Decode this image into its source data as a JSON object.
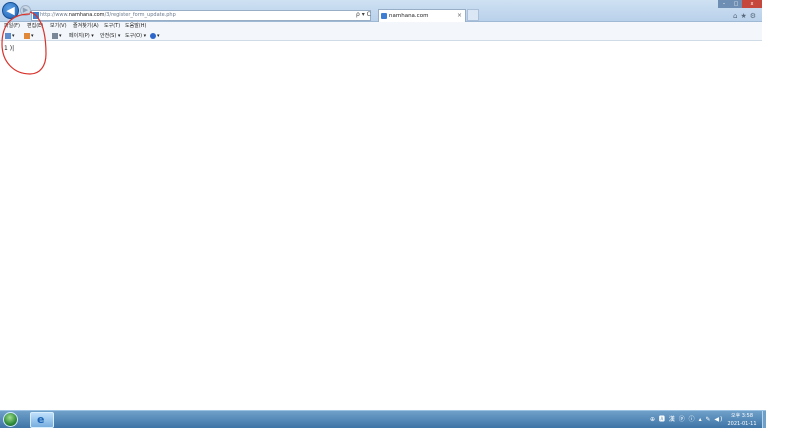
{
  "browser": {
    "url_prefix": "http://www.",
    "url_domain": "namhana.com",
    "url_path": "/3/register_form_update.php",
    "addr_tools": "ρ ▾ C",
    "tab_title": "namhana.com",
    "tab_close": "×",
    "right_icons": "⌂★⚙",
    "back_glyph": "◀",
    "fwd_glyph": "▶",
    "window_controls": {
      "minimize": "–",
      "maximize": "□",
      "close": "x"
    }
  },
  "menubar": {
    "items": [
      "편집(E)",
      "보기(V)",
      "즐겨찾기(A)",
      "도구(T)",
      "도움말(H)"
    ],
    "first_partial": "파일(F)"
  },
  "cmdbar": {
    "items": [
      {
        "label": "▾",
        "icon": "home-icon"
      },
      {
        "label": "▾",
        "icon": "feeds-icon"
      },
      {
        "label": "▾",
        "icon": "print-icon"
      },
      {
        "label": "페이지(P) ▾",
        "icon": ""
      },
      {
        "label": "안전(S) ▾",
        "icon": ""
      },
      {
        "label": "도구(O) ▾",
        "icon": ""
      },
      {
        "label": "▾",
        "icon": "help-icon"
      }
    ]
  },
  "page": {
    "text": "1 )|"
  },
  "taskbar": {
    "tray_text": "⊕ 🅰 漢 ⓟ ⓘ ▴ ✎ ◀)",
    "clock_time": "오후 3:58",
    "clock_date": "2021-01-11"
  },
  "colors": {
    "annotation": "#d9322b",
    "taskbar": "#3e74a6"
  }
}
